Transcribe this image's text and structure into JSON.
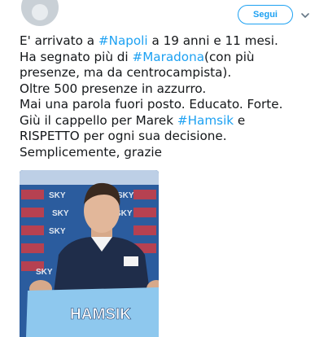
{
  "header": {
    "follow_label": "Segui",
    "caret_icon": "chevron-down-icon"
  },
  "tweet": {
    "lines": [
      {
        "parts": [
          {
            "text": "E' arrivato a "
          },
          {
            "text": "#Napoli",
            "hashtag": true
          },
          {
            "text": " a 19 anni e 11 mesi."
          }
        ]
      },
      {
        "parts": [
          {
            "text": "Ha segnato più di "
          },
          {
            "text": "#Maradona",
            "hashtag": true
          },
          {
            "text": "(con più"
          }
        ]
      },
      {
        "parts": [
          {
            "text": "presenze, ma da centrocampista)."
          }
        ]
      },
      {
        "parts": [
          {
            "text": "Oltre 500 presenze in azzurro."
          }
        ]
      },
      {
        "parts": [
          {
            "text": "Mai una parola fuori posto. Educato. Forte."
          }
        ]
      },
      {
        "parts": [
          {
            "text": "Giù il cappello per Marek "
          },
          {
            "text": "#Hamsik",
            "hashtag": true
          },
          {
            "text": " e"
          }
        ]
      },
      {
        "parts": [
          {
            "text": "RISPETTO per ogni sua decisione."
          }
        ]
      },
      {
        "parts": [
          {
            "text": "Semplicemente, grazie"
          }
        ]
      }
    ],
    "link_color": "#1da1f2"
  },
  "photo": {
    "shirt_text": "HAMSIK",
    "backdrop_text": "SKY",
    "colors": {
      "backdrop": "#2b5c9e",
      "shirt": "#8ec8ee",
      "polo": "#1f2d4a"
    }
  }
}
